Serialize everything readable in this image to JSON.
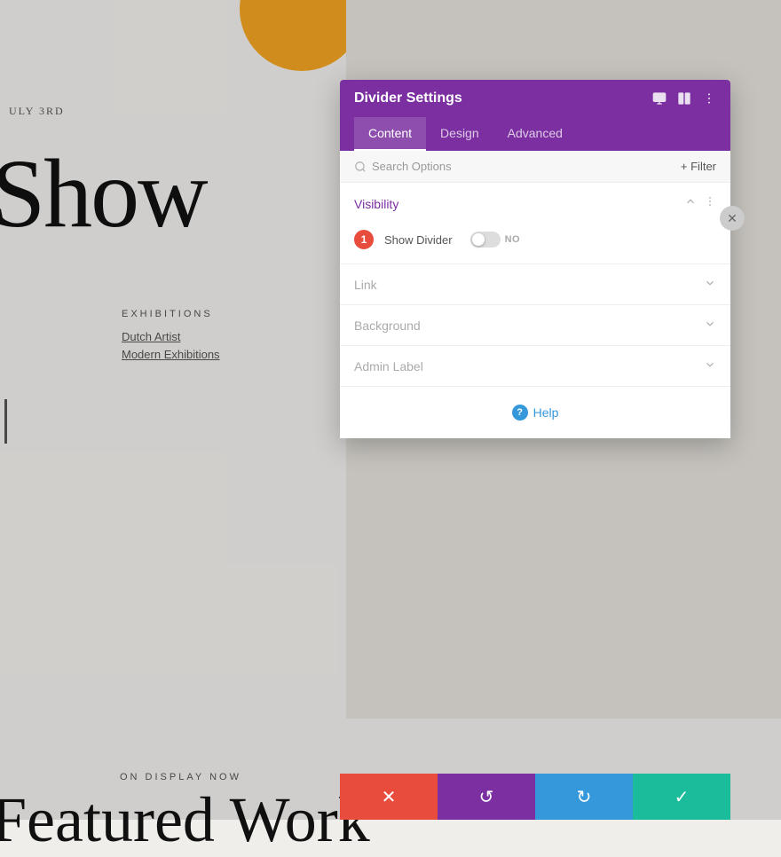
{
  "background": {
    "date": "ULY 3RD",
    "show": "Show",
    "exhibitions_label": "EXHIBITIONS",
    "dutch_artist": "Dutch Artist",
    "modern_exhibitions": "Modern Exhibitions",
    "on_display": "ON DISPLAY NOW",
    "featured_work": "Featured Work"
  },
  "panel": {
    "title": "Divider Settings",
    "tabs": [
      {
        "id": "content",
        "label": "Content",
        "active": true
      },
      {
        "id": "design",
        "label": "Design",
        "active": false
      },
      {
        "id": "advanced",
        "label": "Advanced",
        "active": false
      }
    ],
    "search_placeholder": "Search Options",
    "filter_label": "+ Filter",
    "sections": [
      {
        "id": "visibility",
        "title": "Visibility",
        "expanded": true,
        "fields": [
          {
            "id": "show_divider",
            "label": "Show Divider",
            "type": "toggle",
            "value": false,
            "toggle_label": "NO",
            "badge": "1"
          }
        ]
      },
      {
        "id": "link",
        "title": "Link",
        "expanded": false
      },
      {
        "id": "background",
        "title": "Background",
        "expanded": false
      },
      {
        "id": "admin_label",
        "title": "Admin Label",
        "expanded": false
      }
    ],
    "help_label": "Help"
  },
  "toolbar": {
    "cancel_icon": "✕",
    "undo_icon": "↺",
    "redo_icon": "↻",
    "save_icon": "✓"
  }
}
